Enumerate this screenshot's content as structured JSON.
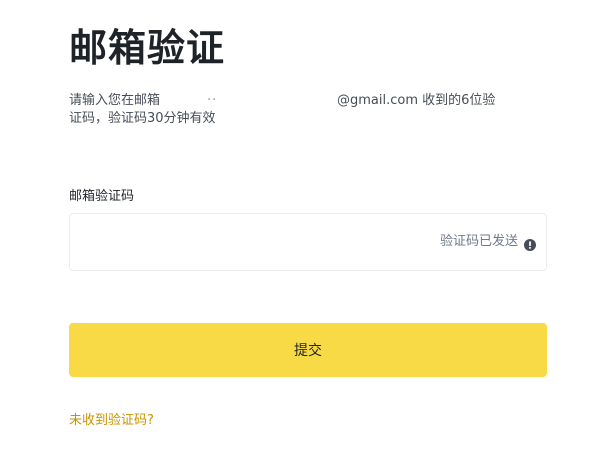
{
  "page": {
    "title": "邮箱验证",
    "description_prefix": "请输入您在邮箱",
    "masked_email_fragment": "..",
    "description_suffix": "@gmail.com 收到的6位验",
    "description_line2": "证码，验证码30分钟有效"
  },
  "form": {
    "code_label": "邮箱验证码",
    "code_value": "",
    "sent_status": "验证码已发送",
    "status_icon": "info-icon",
    "submit_label": "提交",
    "resend_link": "未收到验证码?"
  },
  "colors": {
    "primary_button": "#f8d946",
    "link": "#c99400",
    "title": "#1e2329",
    "muted": "#707a8a"
  }
}
